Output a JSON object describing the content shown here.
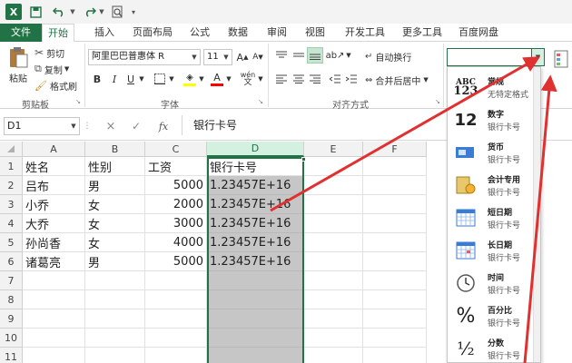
{
  "ribbon_tabs": {
    "file": "文件",
    "home": "开始",
    "insert": "插入",
    "page_layout": "页面布局",
    "formulas": "公式",
    "data": "数据",
    "review": "审阅",
    "view": "视图",
    "developer": "开发工具",
    "more_tools": "更多工具",
    "baidu_pan": "百度网盘"
  },
  "clipboard": {
    "paste": "粘贴",
    "cut": "剪切",
    "copy": "复制",
    "format_painter": "格式刷",
    "group_label": "剪贴板"
  },
  "font": {
    "name": "阿里巴巴普惠体 R",
    "size": "11",
    "group_label": "字体",
    "bold": "B",
    "italic": "I",
    "underline": "U",
    "fill_color": "#ffff00",
    "font_color": "#ff0000"
  },
  "alignment": {
    "wrap_text": "自动换行",
    "merge_center": "合并后居中",
    "group_label": "对齐方式"
  },
  "number_format_box": {
    "value": ""
  },
  "formula_bar": {
    "name_box": "D1",
    "cancel": "×",
    "enter": "✓",
    "fx": "fx",
    "content": "银行卡号"
  },
  "grid": {
    "columns": [
      "A",
      "B",
      "C",
      "D",
      "E",
      "F"
    ],
    "rows": [
      "1",
      "2",
      "3",
      "4",
      "5",
      "6",
      "7",
      "8",
      "9",
      "10",
      "11"
    ],
    "cells": [
      [
        "姓名",
        "性别",
        "工资",
        "银行卡号"
      ],
      [
        "吕布",
        "男",
        "5000",
        "1.23457E+16"
      ],
      [
        "小乔",
        "女",
        "2000",
        "1.23457E+16"
      ],
      [
        "大乔",
        "女",
        "3000",
        "1.23457E+16"
      ],
      [
        "孙尚香",
        "女",
        "4000",
        "1.23457E+16"
      ],
      [
        "诸葛亮",
        "男",
        "5000",
        "1.23457E+16"
      ]
    ]
  },
  "format_panel": {
    "items": [
      {
        "name": "常规",
        "sub": "无特定格式",
        "icon_text": "ABC\n123",
        "icon": "general-format-icon"
      },
      {
        "name": "数字",
        "sub": "银行卡号",
        "icon_text": "12",
        "icon": "number-format-icon"
      },
      {
        "name": "货币",
        "sub": "银行卡号",
        "icon_text": "",
        "icon": "currency-format-icon"
      },
      {
        "name": "会计专用",
        "sub": "银行卡号",
        "icon_text": "",
        "icon": "accounting-format-icon"
      },
      {
        "name": "短日期",
        "sub": "银行卡号",
        "icon_text": "",
        "icon": "short-date-format-icon"
      },
      {
        "name": "长日期",
        "sub": "银行卡号",
        "icon_text": "",
        "icon": "long-date-format-icon"
      },
      {
        "name": "时间",
        "sub": "银行卡号",
        "icon_text": "",
        "icon": "time-format-icon"
      },
      {
        "name": "百分比",
        "sub": "银行卡号",
        "icon_text": "%",
        "icon": "percent-format-icon"
      },
      {
        "name": "分数",
        "sub": "银行卡号",
        "icon_text": "½",
        "icon": "fraction-format-icon"
      }
    ]
  },
  "colors": {
    "excel_green": "#217346",
    "arrow_red": "#e03030",
    "selection_gray": "#c6c6c6"
  }
}
